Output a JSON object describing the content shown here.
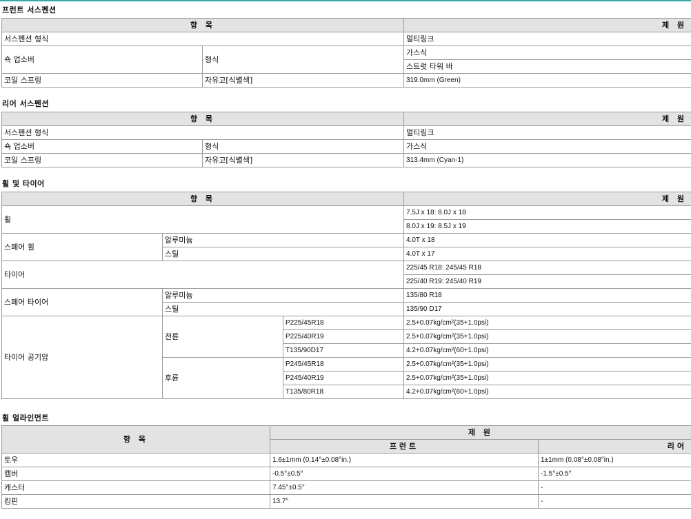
{
  "s1": {
    "title": "프런트 서스펜션",
    "h_item": "항 목",
    "h_spec": "제 원",
    "r1": {
      "label": "서스펜션 형식",
      "value": "멀티링크"
    },
    "r2": {
      "label": "쇽 업소버",
      "sub": "형식",
      "v1": "가스식",
      "v2": "스트럿 타워 바"
    },
    "r3": {
      "label": "코일 스프링",
      "sub": "자유고[식별색]",
      "value": "319.0mm (Green)"
    }
  },
  "s2": {
    "title": "리어 서스펜션",
    "h_item": "항 목",
    "h_spec": "제 원",
    "r1": {
      "label": "서스펜션 형식",
      "value": "멀티링크"
    },
    "r2": {
      "label": "쇽 업소버",
      "sub": "형식",
      "value": "가스식"
    },
    "r3": {
      "label": "코일 스프링",
      "sub": "자유고[식별색]",
      "value": "313.4mm (Cyan-1)"
    }
  },
  "s3": {
    "title": "휠 및 타이어",
    "h_item": "항 목",
    "h_spec": "제 원",
    "wheel": {
      "label": "휠",
      "v1": "7.5J x 18: 8.0J x 18",
      "v2": "8.0J x 19: 8.5J x 19"
    },
    "spare_wheel": {
      "label": "스페어 휠",
      "alu": "알루미늄",
      "alu_v": "4.0T x 18",
      "steel": "스틸",
      "steel_v": "4.0T x 17"
    },
    "tire": {
      "label": "타이어",
      "v1": "225/45 R18: 245/45 R18",
      "v2": "225/40 R19: 245/40 R19"
    },
    "spare_tire": {
      "label": "스페어 타이어",
      "alu": "알루미늄",
      "alu_v": "135/80 R18",
      "steel": "스틸",
      "steel_v": "135/90 D17"
    },
    "pressure": {
      "label": "타이어 공기압",
      "front": "전륜",
      "rear": "후륜",
      "f": [
        {
          "size": "P225/45R18",
          "value": "2.5+0.07kg/cm²(35+1.0psi)"
        },
        {
          "size": "P225/40R19",
          "value": "2.5+0.07kg/cm²(35+1.0psi)"
        },
        {
          "size": "T135/90D17",
          "value": "4.2+0.07kg/cm²(60+1.0psi)"
        }
      ],
      "r": [
        {
          "size": "P245/45R18",
          "value": "2.5+0.07kg/cm²(35+1.0psi)"
        },
        {
          "size": "P245/40R19",
          "value": "2.5+0.07kg/cm²(35+1.0psi)"
        },
        {
          "size": "T135/80R18",
          "value": "4.2+0.07kg/cm²(60+1.0psi)"
        }
      ]
    }
  },
  "s4": {
    "title": "휠 얼라인먼트",
    "h_item": "항 목",
    "h_spec": "제 원",
    "h_front": "프런트",
    "h_rear": "리어",
    "rows": [
      {
        "label": "토우",
        "front": "1.6±1mm (0.14°±0.08°in.)",
        "rear": "1±1mm (0.08°±0.08°in.)"
      },
      {
        "label": "캠버",
        "front": "-0.5°±0.5°",
        "rear": "-1.5°±0.5°"
      },
      {
        "label": "캐스터",
        "front": "7.45°±0.5°",
        "rear": "-"
      },
      {
        "label": "킹핀",
        "front": "13.7°",
        "rear": "-"
      }
    ]
  }
}
